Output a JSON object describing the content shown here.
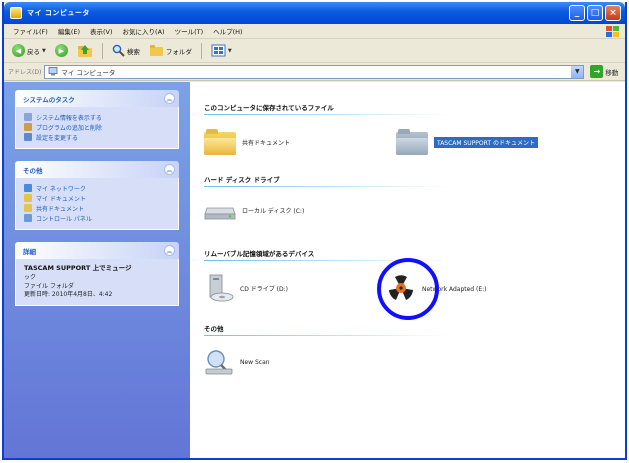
{
  "window": {
    "title": "マイ コンピュータ"
  },
  "caption": {
    "minimize": "_",
    "maximize": "□",
    "close": "×"
  },
  "menu": [
    "ファイル(F)",
    "編集(E)",
    "表示(V)",
    "お気に入り(A)",
    "ツール(T)",
    "ヘルプ(H)"
  ],
  "toolbar": {
    "back": "戻る",
    "search": "検索",
    "folders": "フォルダ"
  },
  "address": {
    "label": "アドレス(D)",
    "value": "マイ コンピュータ",
    "go": "移動"
  },
  "taskpane": {
    "system": {
      "title": "システムのタスク",
      "items": [
        "システム情報を表示する",
        "プログラムの追加と削除",
        "設定を変更する"
      ]
    },
    "other": {
      "title": "その他",
      "items": [
        "マイ ネットワーク",
        "マイ ドキュメント",
        "共有ドキュメント",
        "コントロール パネル"
      ]
    },
    "details": {
      "title": "詳細",
      "name": "TASCAM SUPPORT 上でミュージ",
      "lines": [
        "ック",
        "ファイル フォルダ",
        "更新日時: 2010年4月8日、4:42"
      ]
    }
  },
  "content": {
    "groups": {
      "stored": "このコンピュータに保存されているファイル",
      "harddisk": "ハード ディスク ドライブ",
      "removable": "リムーバブル記憶領域があるデバイス",
      "other": "その他"
    },
    "items": {
      "shared_docs": "共有ドキュメント",
      "user_docs": "TASCAM SUPPORT のドキュメント",
      "local_disk": "ローカル ディスク (C:)",
      "cd_drive": "CD ドライブ (D:)",
      "network": "Network Adapted (E:)",
      "new_scan": "New Scan"
    }
  }
}
